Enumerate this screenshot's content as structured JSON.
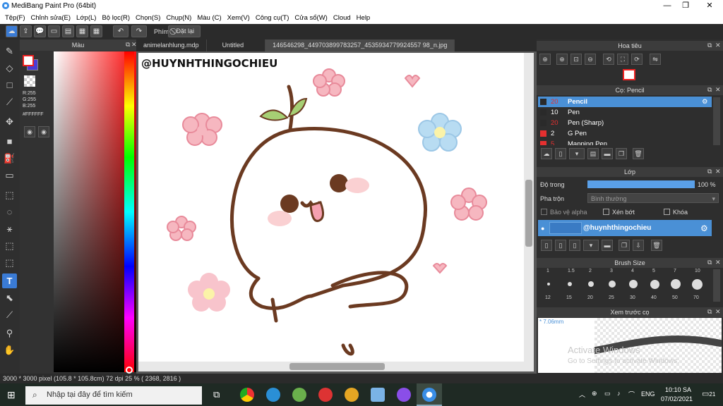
{
  "window": {
    "title": "MediBang Paint Pro (64bit)",
    "min": "—",
    "max": "❐",
    "close": "✕"
  },
  "menu": [
    "Tệp(F)",
    "Chỉnh sửa(E)",
    "Lớp(L)",
    "Bộ lọc(R)",
    "Chọn(S)",
    "Chụp(N)",
    "Màu (C)",
    "Xem(V)",
    "Công cụ(T)",
    "Cửa sổ(W)",
    "Cloud",
    "Help"
  ],
  "toolbar": {
    "phim_label": "Phím",
    "clear_label": "Đặt lại"
  },
  "color_panel": {
    "title": "Màu",
    "r": "R:255",
    "g": "G:255",
    "b": "B:255",
    "hex": "#FFFFFF",
    "primary": "#ffffff",
    "secondary": "#4a3bd6"
  },
  "doc_tabs": [
    "animelanhlung.mdp",
    "Untitled",
    "146546298_449703899783257_4535934779924557 98_n.jpg"
  ],
  "canvas": {
    "watermark": "@HUYNHTHINGOCHIEU"
  },
  "status": {
    "text": "3000 * 3000 pixel    (105.8 * 105.8cm)    72 dpi    25 %    ( 2368, 2816 )"
  },
  "navigator": {
    "title": "Hoa tiêu"
  },
  "brush_panel": {
    "title": "Cọ: Pencil",
    "items": [
      {
        "size": "20",
        "name": "Pencil",
        "color": "#2a2a2a"
      },
      {
        "size": "10",
        "name": "Pen",
        "color": "#2a2a2a"
      },
      {
        "size": "20",
        "name": "Pen (Sharp)",
        "color": "#2a2a2a"
      },
      {
        "size": "2",
        "name": "G Pen",
        "color": "#e53030"
      },
      {
        "size": "5",
        "name": "Mapping Pen",
        "color": "#e53030"
      }
    ]
  },
  "layer_panel": {
    "title": "Lớp",
    "opacity_label": "Độ trong",
    "opacity_value": "100 %",
    "opacity": 1.0,
    "blend_label": "Pha trộn",
    "blend_value": "Bình thường",
    "protect_alpha": "Bảo vệ alpha",
    "clipping": "Xén bớt",
    "lock": "Khóa",
    "layer_name": "@huynhthingochieu"
  },
  "brush_size": {
    "title": "Brush Size",
    "top": [
      "1",
      "1.5",
      "2",
      "3",
      "4",
      "5",
      "7",
      "10"
    ],
    "bottom": [
      "12",
      "15",
      "20",
      "25",
      "30",
      "40",
      "50",
      "70"
    ]
  },
  "preview": {
    "title": "Xem trước cọ",
    "size": "* 7.06mm",
    "activate1": "Activate Windows",
    "activate2": "Go to Settings to activate Windows."
  },
  "taskbar": {
    "search_placeholder": "Nhập tại đây để tìm kiếm",
    "lang": "ENG",
    "time": "10:10 SA",
    "date": "07/02/2021",
    "notif": "21"
  }
}
